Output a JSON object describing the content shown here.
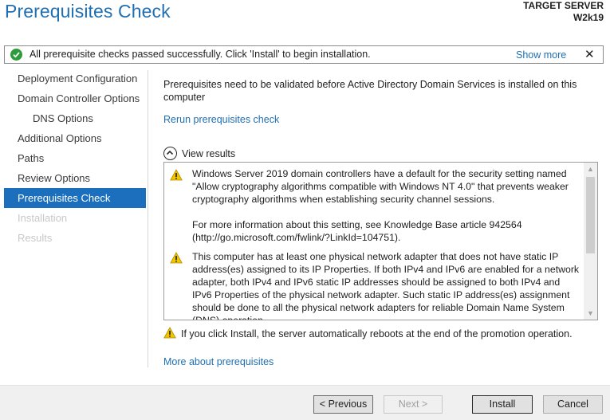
{
  "header": {
    "title": "Prerequisites Check",
    "target_label": "TARGET SERVER",
    "target_name": "W2k19"
  },
  "banner": {
    "status_icon": "check-circle-icon",
    "message": "All prerequisite checks passed successfully.  Click 'Install' to begin installation.",
    "show_more": "Show more",
    "close": "✕"
  },
  "nav": {
    "items": [
      {
        "label": "Deployment Configuration",
        "state": "normal"
      },
      {
        "label": "Domain Controller Options",
        "state": "normal"
      },
      {
        "label": "DNS Options",
        "state": "sub"
      },
      {
        "label": "Additional Options",
        "state": "normal"
      },
      {
        "label": "Paths",
        "state": "normal"
      },
      {
        "label": "Review Options",
        "state": "normal"
      },
      {
        "label": "Prerequisites Check",
        "state": "active"
      },
      {
        "label": "Installation",
        "state": "disabled"
      },
      {
        "label": "Results",
        "state": "disabled"
      }
    ]
  },
  "main": {
    "intro": "Prerequisites need to be validated before Active Directory Domain Services is installed on this computer",
    "rerun_link": "Rerun prerequisites check",
    "view_results": "View results",
    "results": [
      {
        "icon": "warning-icon",
        "paragraphs": [
          "Windows Server 2019 domain controllers have a default for the security setting named \"Allow cryptography algorithms compatible with Windows NT 4.0\" that prevents weaker cryptography algorithms when establishing security channel sessions.",
          "For more information about this setting, see Knowledge Base article 942564 (http://go.microsoft.com/fwlink/?LinkId=104751)."
        ]
      },
      {
        "icon": "warning-icon",
        "paragraphs": [
          "This computer has at least one physical network adapter that does not have static IP address(es) assigned to its IP Properties. If both IPv4 and IPv6 are enabled for a network adapter, both IPv4 and IPv6 static IP addresses should be assigned to both IPv4 and IPv6 Properties of the physical network adapter. Such static IP address(es) assignment should be done to all the physical network adapters for reliable Domain Name System (DNS) operation."
        ]
      }
    ],
    "reboot_note": "If you click Install, the server automatically reboots at the end of the promotion operation.",
    "more_link": "More about prerequisites"
  },
  "footer": {
    "previous": "< Previous",
    "next": "Next >",
    "install": "Install",
    "cancel": "Cancel"
  },
  "colors": {
    "accent": "#1f6fb2",
    "nav_active": "#1b6fbd",
    "success": "#2e9c3a",
    "warning": "#f2c500"
  }
}
